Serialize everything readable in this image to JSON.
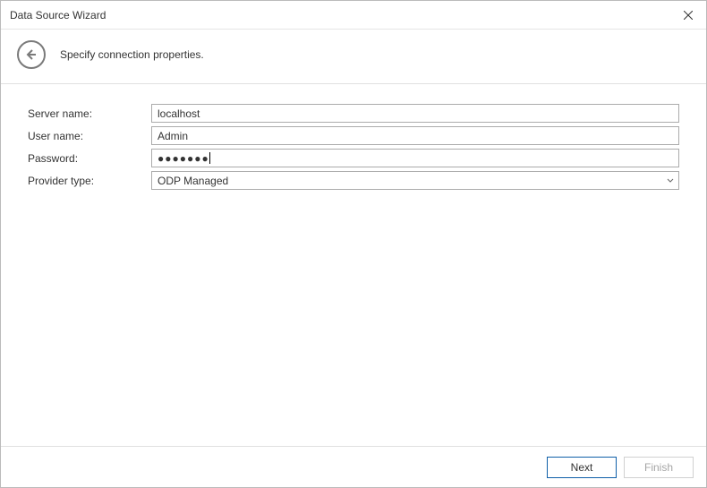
{
  "window": {
    "title": "Data Source Wizard"
  },
  "header": {
    "subtitle": "Specify connection properties."
  },
  "form": {
    "server_name": {
      "label": "Server name:",
      "value": "localhost"
    },
    "user_name": {
      "label": "User name:",
      "value": "Admin"
    },
    "password": {
      "label": "Password:",
      "masked": "●●●●●●●"
    },
    "provider": {
      "label": "Provider type:",
      "selected": "ODP Managed"
    }
  },
  "footer": {
    "next": "Next",
    "finish": "Finish"
  }
}
